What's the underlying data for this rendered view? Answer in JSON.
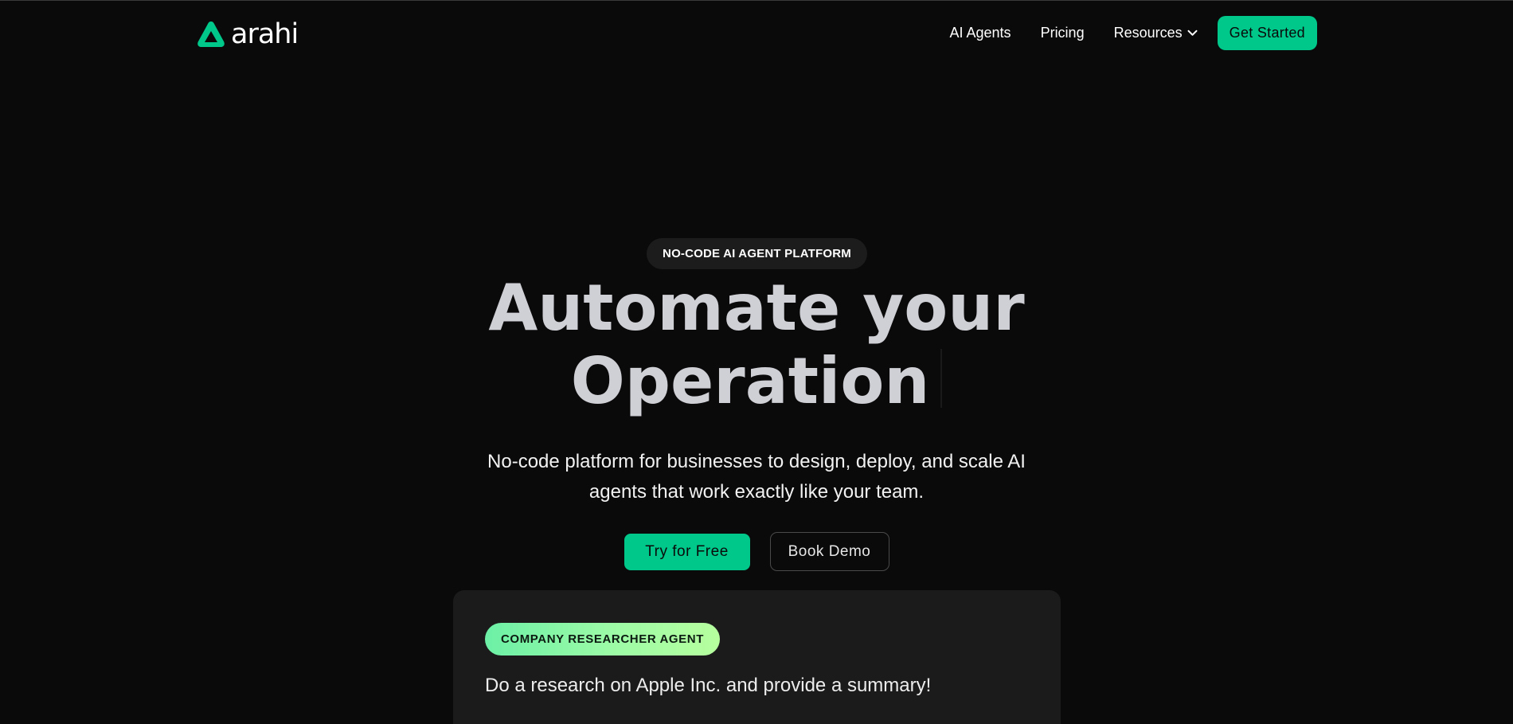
{
  "header": {
    "logo_text": "arahi",
    "nav": [
      {
        "label": "AI Agents"
      },
      {
        "label": "Pricing"
      },
      {
        "label": "Resources",
        "icon": "chevron-down-icon"
      }
    ],
    "cta_label": "Get Started"
  },
  "hero": {
    "eyebrow": "NO-CODE AI AGENT PLATFORM",
    "headline_line1": "Automate your",
    "headline_line2": "Operation",
    "subtitle": "No-code platform for businesses to design, deploy, and scale AI agents that work exactly like your team.",
    "primary_cta": "Try for Free",
    "secondary_cta": "Book Demo"
  },
  "demo_card": {
    "badge": "COMPANY RESEARCHER AGENT",
    "prompt": "Do a research on Apple Inc. and provide a summary!"
  },
  "colors": {
    "background": "#0a0a0a",
    "accent": "#00c88a",
    "headline": "#cfcfd6",
    "card": "#1b1b1b"
  }
}
